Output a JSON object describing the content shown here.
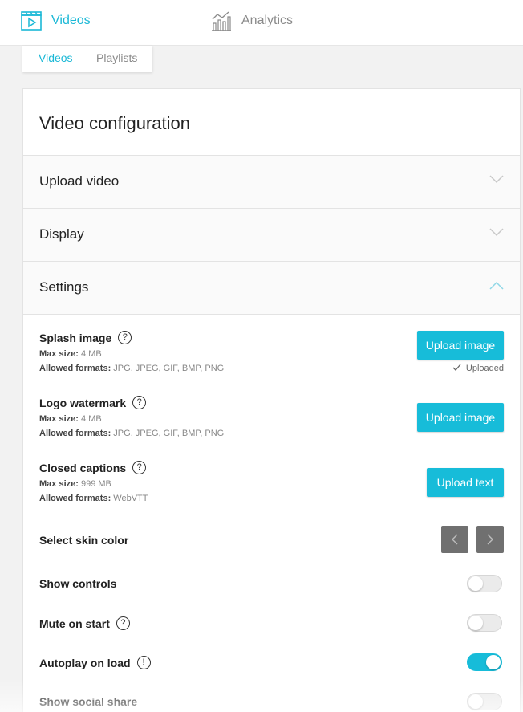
{
  "nav": {
    "videos": {
      "label": "Videos",
      "icon": "video-clapper-icon"
    },
    "analytics": {
      "label": "Analytics",
      "icon": "bar-chart-icon"
    }
  },
  "subtabs": {
    "videos": "Videos",
    "playlists": "Playlists"
  },
  "card": {
    "title": "Video configuration",
    "sections": {
      "upload": {
        "label": "Upload video",
        "expanded": false
      },
      "display": {
        "label": "Display",
        "expanded": false
      },
      "settings": {
        "label": "Settings",
        "expanded": true
      }
    }
  },
  "settings": {
    "splash": {
      "title": "Splash image",
      "help": "?",
      "max_label": "Max size:",
      "max_value": "4 MB",
      "formats_label": "Allowed formats:",
      "formats_value": "JPG, JPEG, GIF, BMP, PNG",
      "button": "Upload image",
      "status": "Uploaded"
    },
    "logo": {
      "title": "Logo watermark",
      "help": "?",
      "max_label": "Max size:",
      "max_value": "4 MB",
      "formats_label": "Allowed formats:",
      "formats_value": "JPG, JPEG, GIF, BMP, PNG",
      "button": "Upload image"
    },
    "captions": {
      "title": "Closed captions",
      "help": "?",
      "max_label": "Max size:",
      "max_value": "999 MB",
      "formats_label": "Allowed formats:",
      "formats_value": "WebVTT",
      "button": "Upload text"
    },
    "skin": {
      "title": "Select skin color"
    },
    "show_controls": {
      "title": "Show controls",
      "on": false
    },
    "mute_on_start": {
      "title": "Mute on start",
      "help": "?",
      "on": false
    },
    "autoplay": {
      "title": "Autoplay on load",
      "help": "!",
      "on": true
    },
    "social_share": {
      "title": "Show social share",
      "on": false
    }
  },
  "colors": {
    "accent": "#17bcd9",
    "arrow_button": "#707070"
  }
}
